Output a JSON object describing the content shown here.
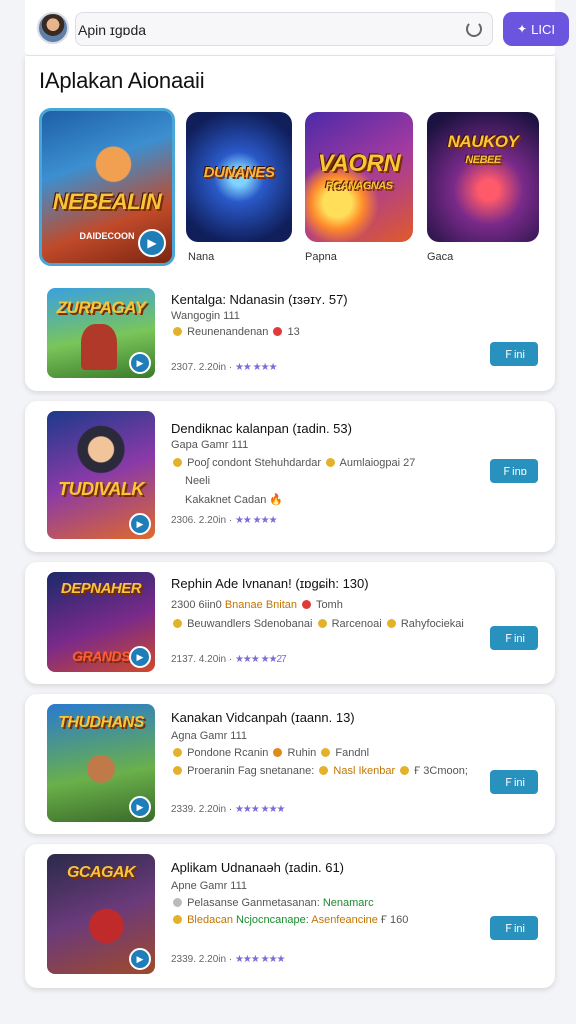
{
  "topbar": {
    "search_value": "Apin ɪgɒda",
    "login_label": "LICI",
    "login_icon": "controller-icon"
  },
  "featured": {
    "title": "IAplakan Aionaaii",
    "tiles": [
      {
        "art": "NEBEALIN",
        "subart": "DAIDECOON",
        "label": ""
      },
      {
        "art": "DUNANES",
        "subart": "",
        "label": "Nana"
      },
      {
        "art": "VAORN",
        "subart": "RCANAGNAS",
        "label": "Papna"
      },
      {
        "art": "NAUKOY",
        "subart": "NEBEE",
        "label": "Gaca"
      }
    ]
  },
  "items": [
    {
      "art": "ZURPAGAY",
      "title": "Kentalga: Ndanasin (ɪɜəɪʏ. 57)",
      "sub1": "Wangogin 111",
      "sub2_a": "Reunenandenan",
      "sub2_b": "13",
      "meta_date": "2307. 2.20in",
      "meta_rating": "★★ ★★★",
      "button": "Ｆini"
    },
    {
      "art": "TUDIVALK",
      "title": "Dendiknac kalanpan (ɪadin. 53)",
      "sub1": "Gapa Gamr 111",
      "sub2_a": "Pooʃ condont Stehuhdardar",
      "sub2_b": "Aumlaiogpai  27",
      "sub3": "Neeli",
      "sub4": "Kakaknet Cadan",
      "meta_date": "2306. 2.20in",
      "meta_rating": "★★ ★★★",
      "button": "Ｆinɒ"
    },
    {
      "art": "DEPNAHER",
      "title": "Rephin Ade Ivnanan! (ɪɒɡɕih: 130)",
      "sub1_a": "2300 6iin0",
      "sub1_b": "Bnanae Bnitan",
      "sub1_c": "Tomh",
      "sub2_a": "Beuwandlers Sdenobanai",
      "sub2_b": "Rarcenoai",
      "sub2_c": "Rahyfociekai",
      "meta_date": "2137. 4.20in",
      "meta_rating": "★★★ ★★27",
      "button": "Ｆini"
    },
    {
      "art": "THUDHANS",
      "title": "Kanakan Vidcanpah (ɪaann. 13)",
      "sub1": "Agna Gamr 111",
      "sub2_a": "Pondone Rcanin",
      "sub2_b": "Ruhin",
      "sub2_c": "Fandnl",
      "sub3_a": "Proeranin Fag snetanane:",
      "sub3_b": "Nasl Ikenbar",
      "sub3_c": "Ғ 3Cmoon;",
      "meta_date": "2339. 2.20in",
      "meta_rating": "★★★ ★★★",
      "button": "Ｆini"
    },
    {
      "art": "GCAGAK",
      "title": "Aplikam Udnanaəh (ɪadin. 61)",
      "sub1": "Apne Gamr 111",
      "sub2_a": "Pelasanse Ganmetasanan:",
      "sub2_b": "Nenamarc",
      "sub3_a": "Bledacan",
      "sub3_b": "Ncjocncanape:",
      "sub3_c": "Asenfeancine",
      "sub3_d": "Ғ 160",
      "meta_date": "2339. 2.20in",
      "meta_rating": "★★★ ★★★",
      "button": "Ｆini"
    }
  ],
  "colors": {
    "accent": "#6b55de",
    "get_button": "#2891bd",
    "highlight_green": "#1a8c2e"
  }
}
